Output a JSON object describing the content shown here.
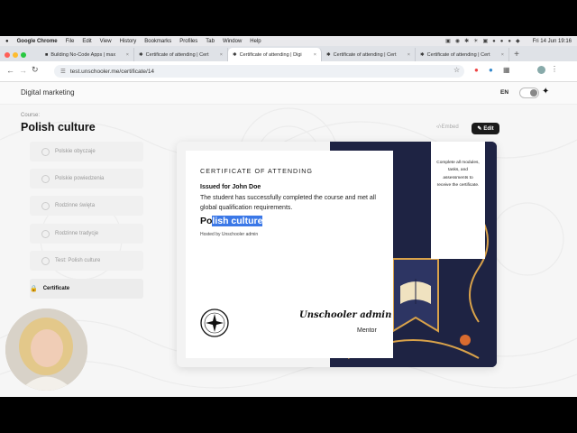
{
  "menubar": {
    "app_name": "Google Chrome",
    "items": [
      "File",
      "Edit",
      "View",
      "History",
      "Bookmarks",
      "Profiles",
      "Tab",
      "Window",
      "Help"
    ],
    "clock": "Fri 14 Jun  19:16"
  },
  "tabs": [
    {
      "label": "Building No-Code Apps | max",
      "active": false
    },
    {
      "label": "Certificate of attending | Cert",
      "active": false
    },
    {
      "label": "Certificate of attending | Digi",
      "active": true
    },
    {
      "label": "Certificate of attending | Cert",
      "active": false
    },
    {
      "label": "Certificate of attending | Cert",
      "active": false
    }
  ],
  "address": {
    "url": "test.unschooler.me/certificate/14"
  },
  "header": {
    "title": "Digital marketing",
    "lang": "EN"
  },
  "course": {
    "label": "Course:",
    "title": "Polish culture",
    "modules": [
      "Polskie obyczaje",
      "Polskie powiedzenia",
      "Rodzinne święta",
      "Rodzinne tradycje",
      "Test: Polish culture"
    ],
    "active_item": "Certificate"
  },
  "toolbar": {
    "embed_label": "Embed",
    "edit_label": "Edit"
  },
  "certificate": {
    "heading": "CERTIFICATE OF ATTENDING",
    "issued_for": "Issued for John Doe",
    "description": "The student has successfully completed the course and met all global qualification requirements.",
    "course_prefix": "Po",
    "course_selected": "lish culture",
    "hosted_by": "Hosted by Unschooler admin",
    "signature": "Unschooler admin",
    "role": "Mentor",
    "ribbon_text": "Complete all modules, tasks, and assessments to receive the certificate."
  },
  "colors": {
    "accent_selection": "#3b78e7",
    "art_navy": "#1e2343",
    "art_gold": "#d9a24a",
    "art_orange": "#d96b2f"
  }
}
